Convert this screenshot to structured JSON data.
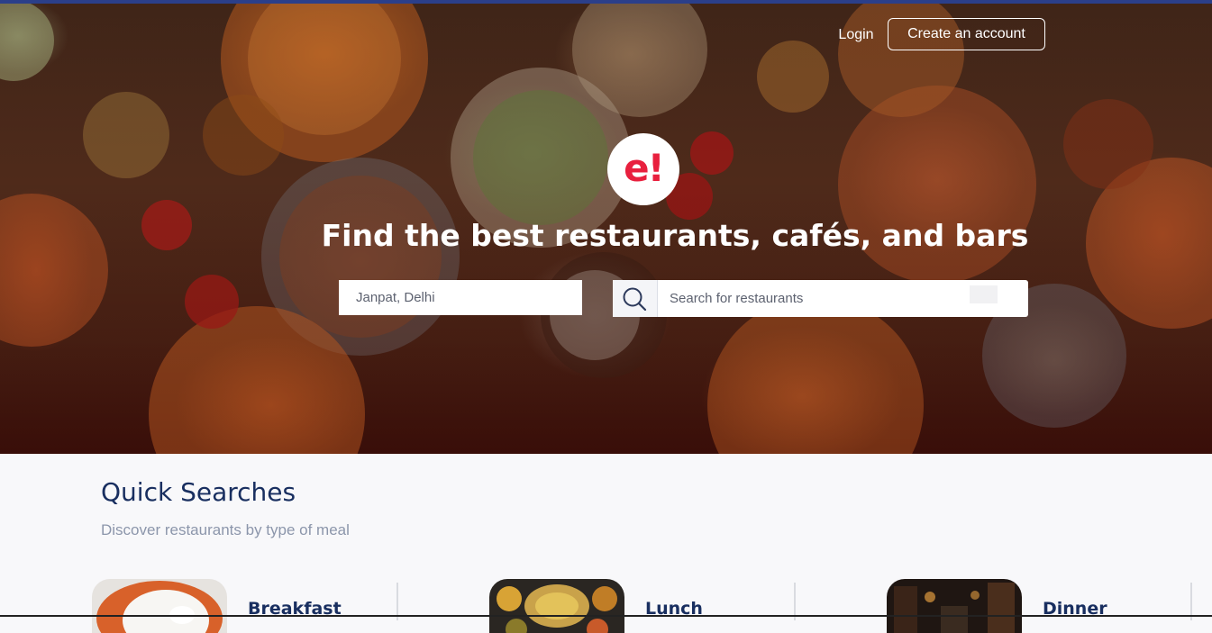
{
  "colors": {
    "brand_red": "#e8203e",
    "heading_navy": "#192f60",
    "subtitle_gray": "#8c96ab",
    "top_bar": "#2b3f8a"
  },
  "header": {
    "login_label": "Login",
    "create_account_label": "Create an account"
  },
  "hero": {
    "logo_text": "e!",
    "headline": "Find the best restaurants, cafés, and bars",
    "location_value": "Janpat, Delhi",
    "search_placeholder": "Search for restaurants",
    "search_icon": "search-icon"
  },
  "quick_searches": {
    "title": "Quick Searches",
    "subtitle": "Discover restaurants by type of meal",
    "cards": [
      {
        "label": "Breakfast",
        "image": "breakfast-image"
      },
      {
        "label": "Lunch",
        "image": "lunch-image"
      },
      {
        "label": "Dinner",
        "image": "dinner-image"
      }
    ]
  }
}
